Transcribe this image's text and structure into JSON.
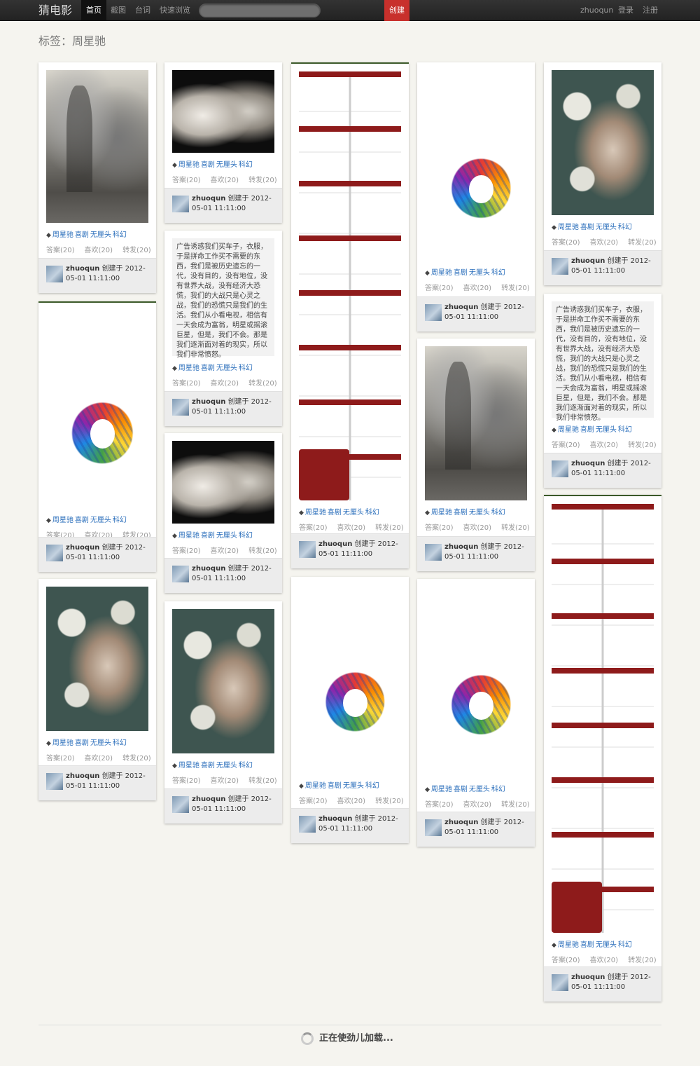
{
  "nav": {
    "brand": "猜电影",
    "links": [
      "首页",
      "截图",
      "台词",
      "快速浏览"
    ],
    "create": "创建",
    "user": "zhuoqun",
    "login": "登录",
    "register": "注册"
  },
  "page_title": "标签：周星驰",
  "card": {
    "tags": [
      "周星驰",
      "喜剧",
      "无厘头",
      "科幻"
    ],
    "stats": [
      "答案(20)",
      "喜欢(20)",
      "转发(20)"
    ],
    "author": "zhuoqun",
    "created": "创建于 2012-05-01 11:11:00"
  },
  "quote_text": "广告诱惑我们买车子，衣服，于是拼命工作买不需要的东西，我们是被历史遗忘的一代，没有目的，没有地位，没有世界大战，没有经济大恐慌，我们的大战只是心灵之战，我们的恐慌只是我们的生活。我们从小看电视，相信有一天会成为富翁，明星或摇滚巨星，但是，我们不会。那是我们逐渐面对着的现实，所以我们非常愤怒。",
  "images": {
    "mountain": "mountain-painting",
    "boy": "boy-and-dog-photo",
    "cat": "cat-dandelion-illustration",
    "color": "color-wheel-infographic",
    "comic": "comic-strip"
  },
  "loading": "正在使劲儿加载..."
}
